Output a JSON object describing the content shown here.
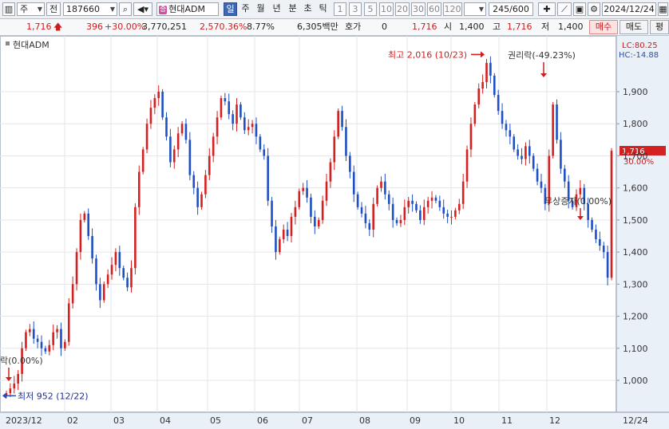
{
  "toolbar": {
    "mode_label": "주",
    "prev_label": "전",
    "code": "187660",
    "stock_name": "현대ADM",
    "stock_badge": "증",
    "periods": [
      "일",
      "주",
      "월",
      "년",
      "분",
      "초",
      "틱"
    ],
    "selected_period": "일",
    "intervals": [
      "1",
      "3",
      "5",
      "10",
      "20",
      "30",
      "60",
      "120"
    ],
    "count": "245/600",
    "date": "2024/12/24"
  },
  "quote": {
    "price": "1,716",
    "change": "396",
    "change_pct": "+30.00%",
    "volume": "3,770,251",
    "volume_pct": "2,570.36%",
    "turnover_pct": "8.77%",
    "amount": "6,305백만",
    "hoga_label": "호가",
    "hoga_value": "0",
    "close": "1,716",
    "open_label": "시",
    "open": "1,400",
    "high_label": "고",
    "high": "1,716",
    "low_label": "저",
    "low": "1,400",
    "buy_label": "매수",
    "sell_label": "매도",
    "eval_label": "평"
  },
  "chart_data": {
    "type": "candlestick",
    "legend": "현대ADM",
    "y_ticks": [
      1000,
      1100,
      1200,
      1300,
      1400,
      1500,
      1600,
      1700,
      1800,
      1900
    ],
    "y_tick_labels": [
      "1,000",
      "1,100",
      "1,200",
      "1,300",
      "1,400",
      "1,500",
      "1,600",
      "1,700",
      "1,800",
      "1,900"
    ],
    "ylim": [
      920,
      2040
    ],
    "x_labels": [
      "2023/12",
      "02",
      "03",
      "04",
      "05",
      "06",
      "07",
      "08",
      "09",
      "10",
      "11",
      "12",
      "12/24"
    ],
    "lc_label": "LC:80.25",
    "hc_label": "HC:-14.88",
    "last_price_label": "1,716",
    "last_pct_label": "30.00%",
    "high_marker": {
      "label": "최고 2,016 (10/23)",
      "value": 2016
    },
    "low_marker": {
      "label": "최저 952 (12/22)",
      "value": 952
    },
    "annotations": [
      {
        "label": "권리락(-49.23%)"
      },
      {
        "label": "무상증자(0.00%)"
      },
      {
        "label": "락(0.00%)"
      }
    ],
    "closes": [
      960,
      975,
      990,
      1020,
      1100,
      1150,
      1160,
      1130,
      1120,
      1100,
      1090,
      1110,
      1150,
      1160,
      1100,
      1120,
      1240,
      1300,
      1400,
      1500,
      1520,
      1450,
      1380,
      1300,
      1250,
      1300,
      1330,
      1360,
      1400,
      1350,
      1320,
      1290,
      1350,
      1540,
      1650,
      1720,
      1800,
      1850,
      1880,
      1900,
      1820,
      1760,
      1680,
      1720,
      1770,
      1800,
      1750,
      1640,
      1600,
      1540,
      1580,
      1640,
      1700,
      1760,
      1820,
      1880,
      1870,
      1830,
      1800,
      1860,
      1820,
      1780,
      1790,
      1800,
      1760,
      1720,
      1700,
      1560,
      1480,
      1400,
      1440,
      1470,
      1450,
      1510,
      1540,
      1590,
      1600,
      1570,
      1510,
      1480,
      1500,
      1560,
      1620,
      1680,
      1760,
      1840,
      1790,
      1700,
      1650,
      1580,
      1540,
      1520,
      1490,
      1470,
      1550,
      1600,
      1620,
      1580,
      1550,
      1500,
      1490,
      1500,
      1540,
      1560,
      1550,
      1530,
      1500,
      1540,
      1560,
      1570,
      1560,
      1540,
      1520,
      1510,
      1510,
      1530,
      1550,
      1620,
      1720,
      1800,
      1860,
      1910,
      1930,
      1990,
      1950,
      1890,
      1840,
      1800,
      1780,
      1760,
      1720,
      1700,
      1690,
      1730,
      1700,
      1660,
      1620,
      1600,
      1550,
      1700,
      1860,
      1750,
      1660,
      1620,
      1560,
      1540,
      1580,
      1600,
      1550,
      1500,
      1470,
      1440,
      1420,
      1400,
      1320,
      1716
    ]
  }
}
